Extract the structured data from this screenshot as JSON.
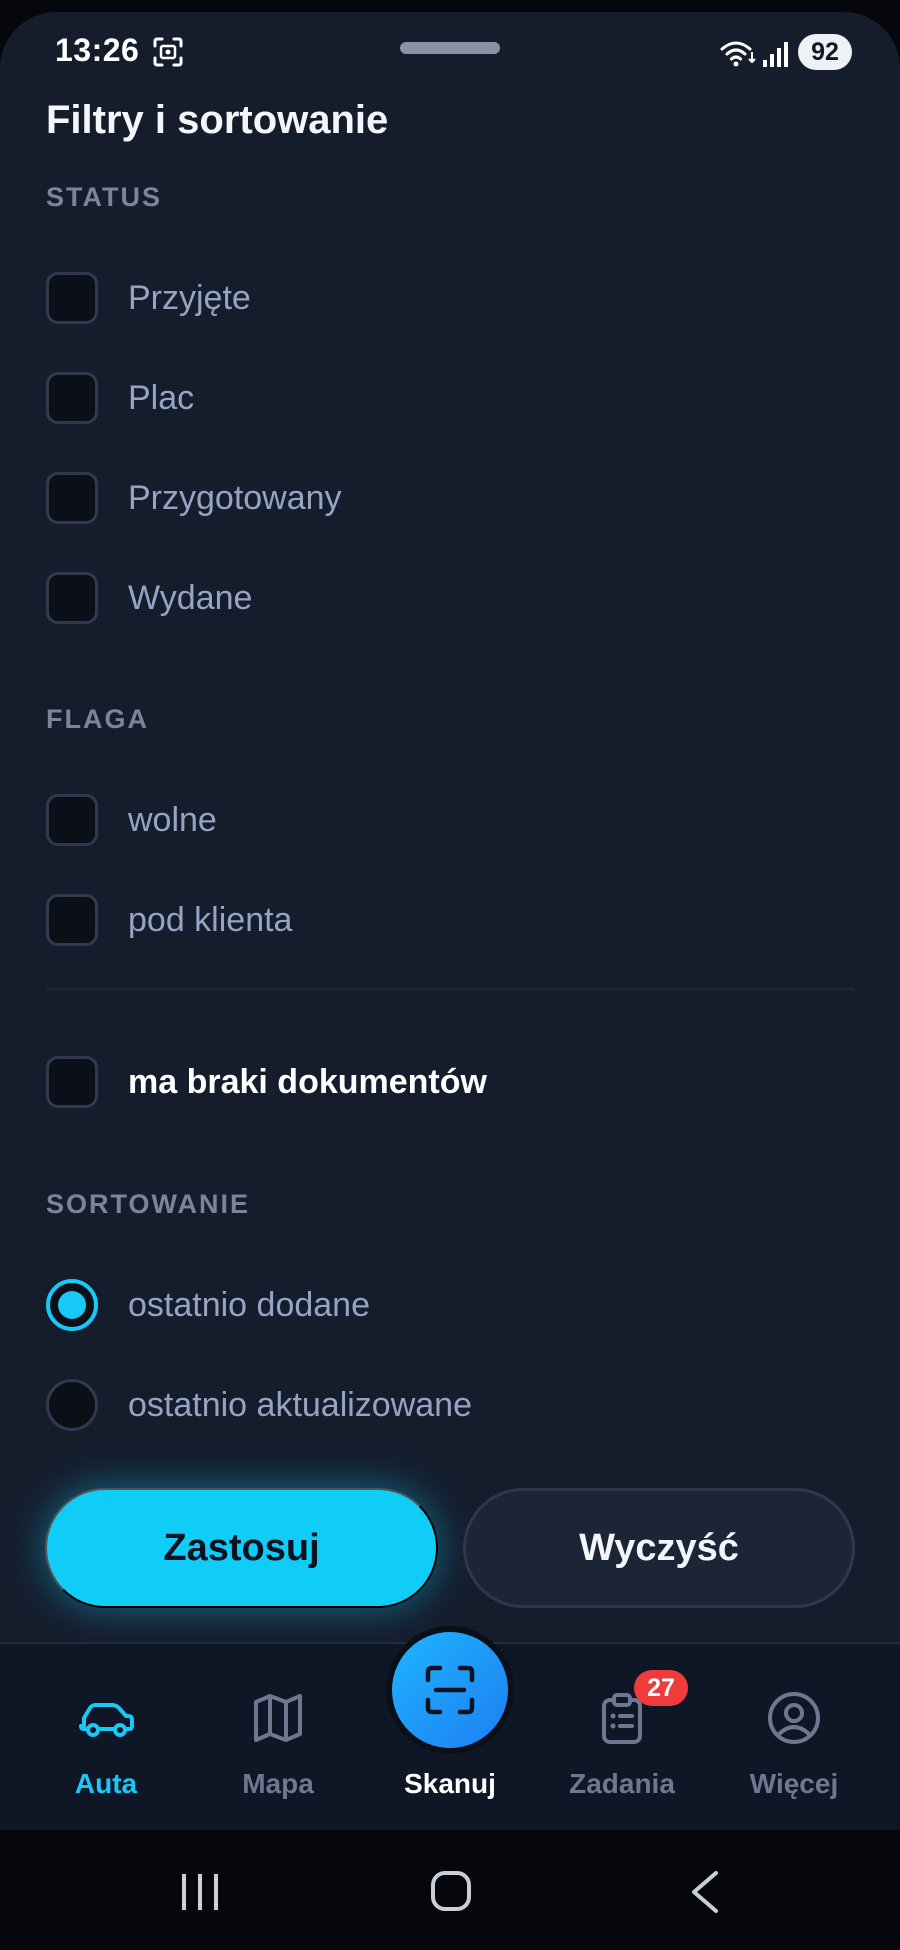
{
  "status_bar": {
    "time": "13:26",
    "battery": "92"
  },
  "page_title": "Filtry i sortowanie",
  "sections": {
    "status": {
      "label": "STATUS",
      "options": [
        {
          "label": "Przyjęte",
          "checked": false
        },
        {
          "label": "Plac",
          "checked": false
        },
        {
          "label": "Przygotowany",
          "checked": false
        },
        {
          "label": "Wydane",
          "checked": false
        }
      ]
    },
    "flag": {
      "label": "FLAGA",
      "options": [
        {
          "label": "wolne",
          "checked": false
        },
        {
          "label": "pod klienta",
          "checked": false
        }
      ]
    },
    "missing_docs": {
      "label": "ma braki dokumentów",
      "checked": false
    },
    "sort": {
      "label": "SORTOWANIE",
      "options": [
        {
          "label": "ostatnio dodane",
          "selected": true
        },
        {
          "label": "ostatnio aktualizowane",
          "selected": false
        }
      ]
    }
  },
  "actions": {
    "apply": "Zastosuj",
    "clear": "Wyczyść"
  },
  "bottom_nav": {
    "items": [
      {
        "label": "Auta",
        "icon": "car-icon",
        "active": true
      },
      {
        "label": "Mapa",
        "icon": "map-icon",
        "active": false
      },
      {
        "label": "Skanuj",
        "icon": "scan-icon",
        "active": false
      },
      {
        "label": "Zadania",
        "icon": "clipboard-list-icon",
        "active": false,
        "badge": "27"
      },
      {
        "label": "Więcej",
        "icon": "user-circle-icon",
        "active": false
      }
    ]
  },
  "colors": {
    "background": "#151d2d",
    "accent": "#18c8f5",
    "badge": "#ef3b3b",
    "muted_text": "#95a4c3"
  }
}
